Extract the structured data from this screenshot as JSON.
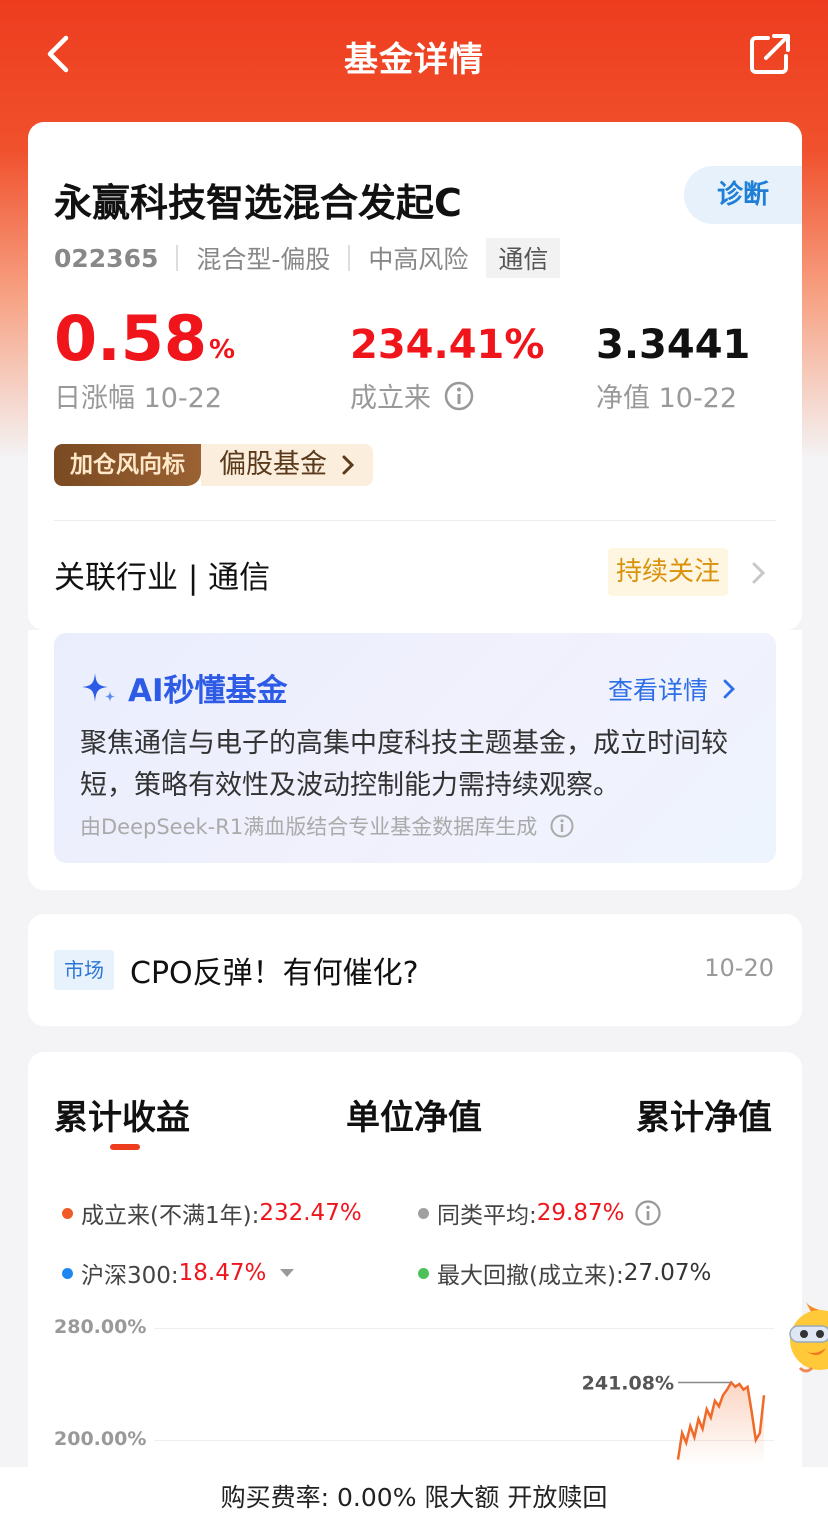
{
  "header": {
    "title": "基金详情"
  },
  "fund": {
    "name": "永赢科技智选混合发起C",
    "diagnose_label": "诊断",
    "code": "022365",
    "type": "混合型-偏股",
    "risk": "中高风险",
    "sector_tag": "通信",
    "daily_change": "0.58",
    "daily_change_unit": "%",
    "daily_change_label": "日涨幅 10-22",
    "since_inception": "234.41%",
    "since_inception_label": "成立来",
    "nav": "3.3441",
    "nav_label": "净值 10-22",
    "badge_left": "加仓风向标",
    "badge_right": "偏股基金",
    "industry": "关联行业 | 通信",
    "follow_label": "持续关注"
  },
  "ai": {
    "title": "AI秒懂基金",
    "more_label": "查看详情",
    "summary": "聚焦通信与电子的高集中度科技主题基金，成立时间较短，策略有效性及波动控制能力需持续观察。",
    "source": "由DeepSeek-R1满血版结合专业基金数据库生成"
  },
  "news": {
    "tag": "市场",
    "title": "CPO反弹！有何催化?",
    "date": "10-20"
  },
  "chart": {
    "tabs": [
      "累计收益",
      "单位净值",
      "累计净值"
    ],
    "legend": [
      {
        "label": "成立来(不满1年):",
        "value": "232.47%",
        "color": "#f05a28"
      },
      {
        "label": "同类平均:",
        "value": "29.87%",
        "color": "#a0a0a0"
      },
      {
        "label": "沪深300:",
        "value": "18.47%",
        "color": "#1e88f0"
      },
      {
        "label": "最大回撤(成立来):",
        "value": "27.07%",
        "color": "#4cc15a"
      }
    ],
    "y_tick_top": "280.00%",
    "y_tick_mid": "200.00%",
    "peak_label": "241.08%",
    "colors": {
      "line": "#f06a2a",
      "accent": "#ee3c1f"
    }
  },
  "chart_data": {
    "type": "area",
    "ylim": [
      200,
      280
    ],
    "yticks": [
      "280.00%",
      "200.00%"
    ],
    "annotation": "241.08%",
    "series": [
      {
        "values": [
          186,
          205,
          198,
          210,
          202,
          215,
          208,
          222,
          216,
          228,
          224,
          232,
          236,
          241.08,
          238,
          240,
          236,
          238,
          220,
          200,
          205,
          232
        ]
      }
    ]
  },
  "footer": {
    "text": "购买费率: 0.00% 限大额 开放赎回"
  }
}
